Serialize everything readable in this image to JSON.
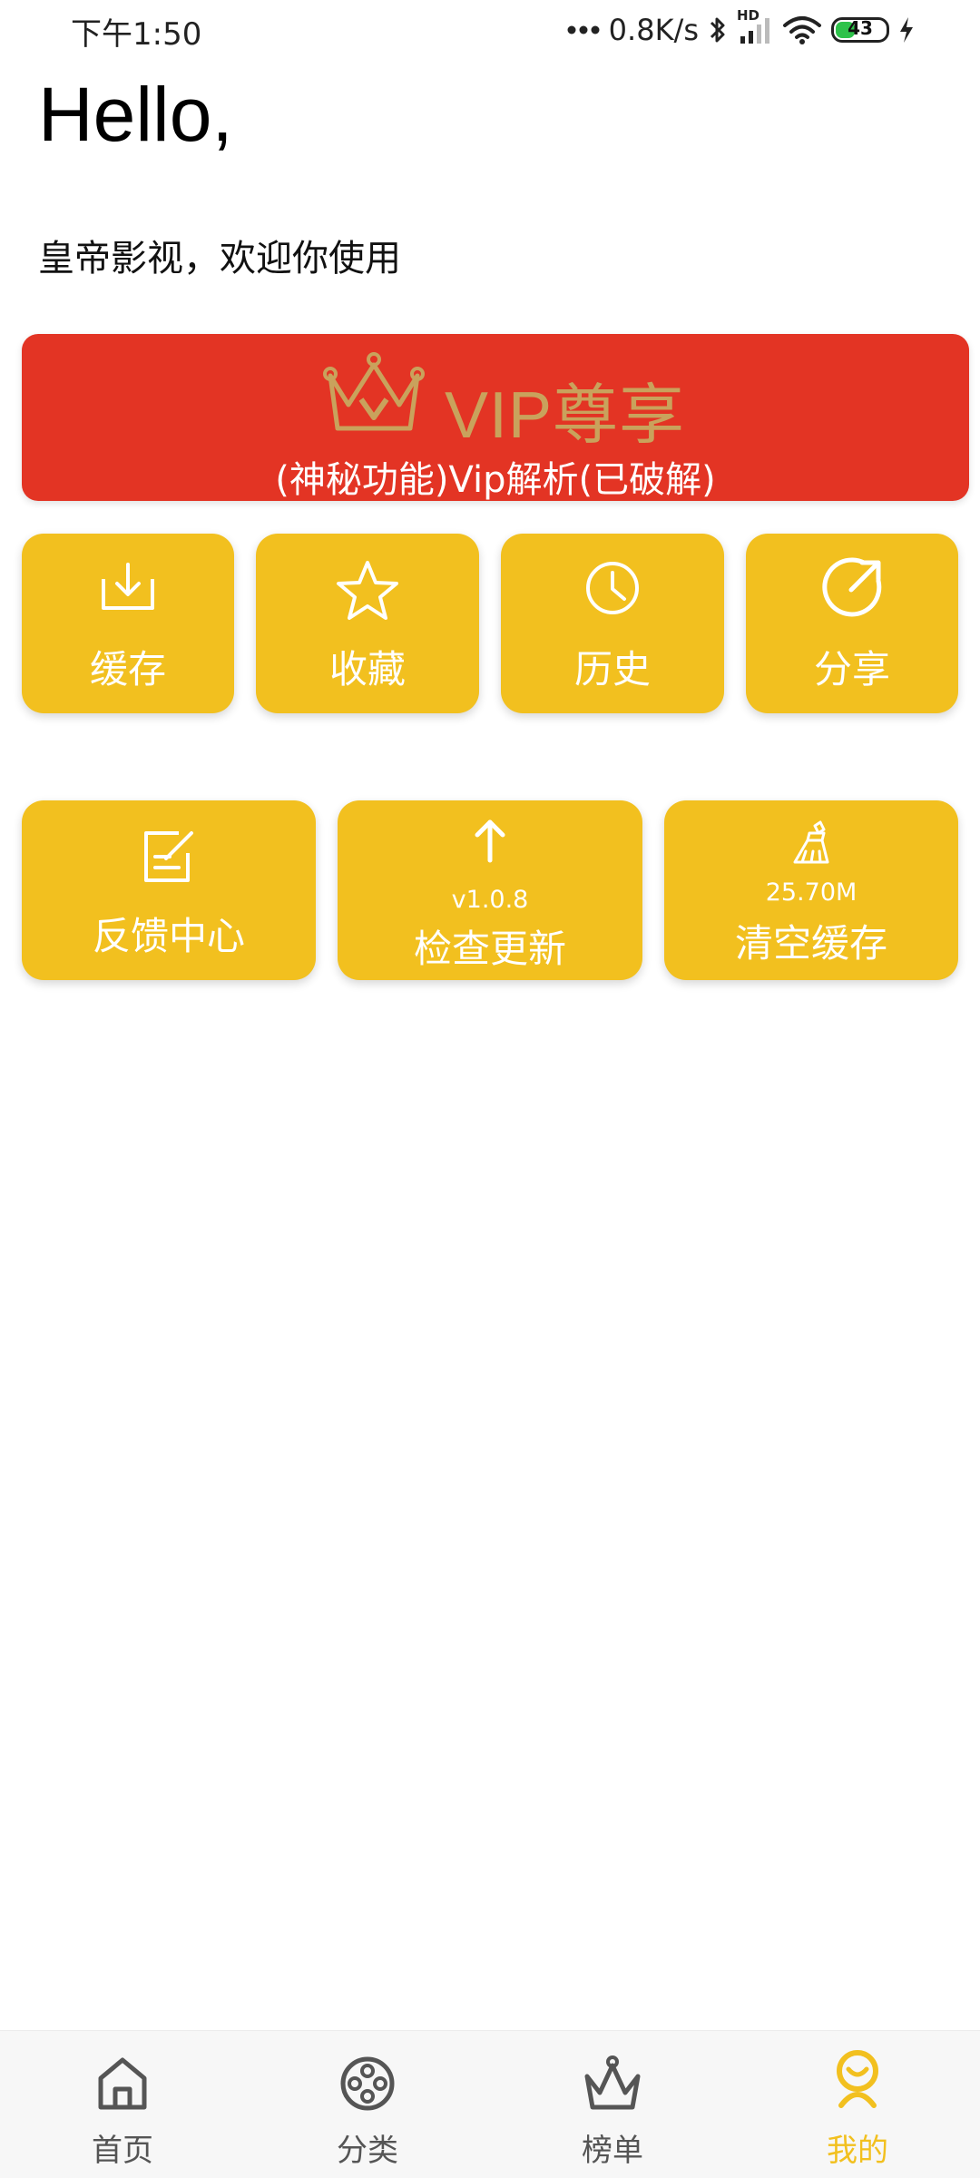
{
  "status_bar": {
    "time": "下午1:50",
    "network_speed": "0.8K/s",
    "hd_label": "HD",
    "battery_level": "43",
    "battery_fraction": 0.43,
    "icons": [
      "more-dots-icon",
      "bluetooth-icon",
      "cell-signal-icon",
      "wifi-icon",
      "battery-icon",
      "charging-bolt-icon"
    ]
  },
  "greeting": {
    "title": "Hello,",
    "subtitle": "皇帝影视，欢迎你使用"
  },
  "vip_banner": {
    "title": "VIP尊享",
    "subtitle": "(神秘功能)Vip解析(已破解)",
    "icon": "crown-icon",
    "background_color": "#e33424",
    "title_color": "#c9a25c"
  },
  "quick_actions": [
    {
      "label": "缓存",
      "icon": "download-tray-icon"
    },
    {
      "label": "收藏",
      "icon": "star-icon"
    },
    {
      "label": "历史",
      "icon": "clock-icon"
    },
    {
      "label": "分享",
      "icon": "share-arrow-icon"
    }
  ],
  "tools": {
    "feedback": {
      "label": "反馈中心",
      "icon": "edit-note-icon"
    },
    "update": {
      "label": "检查更新",
      "version": "v1.0.8",
      "icon": "arrow-up-icon"
    },
    "clear_cache": {
      "label": "清空缓存",
      "size": "25.70M",
      "icon": "broom-icon"
    }
  },
  "tile_color": "#f2c01f",
  "bottom_nav": [
    {
      "label": "首页",
      "icon": "home-icon",
      "active": false
    },
    {
      "label": "分类",
      "icon": "film-reel-icon",
      "active": false
    },
    {
      "label": "榜单",
      "icon": "crown-icon",
      "active": false
    },
    {
      "label": "我的",
      "icon": "person-icon",
      "active": true
    }
  ],
  "active_color": "#f2c01f"
}
